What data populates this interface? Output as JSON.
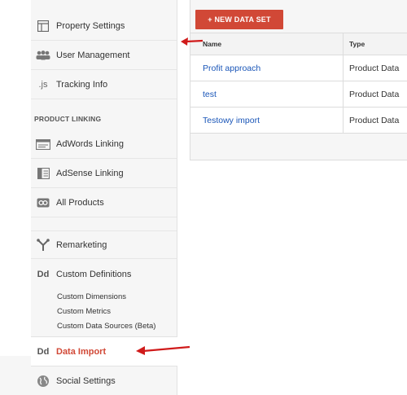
{
  "sidebar": {
    "items": [
      {
        "label": "Property Settings",
        "icon": "property-settings-icon"
      },
      {
        "label": "User Management",
        "icon": "users-icon"
      },
      {
        "label": "Tracking Info",
        "icon": "js-icon",
        "icon_text": ".js"
      }
    ],
    "section_header": "PRODUCT LINKING",
    "linking_items": [
      {
        "label": "AdWords Linking",
        "icon": "adwords-icon"
      },
      {
        "label": "AdSense Linking",
        "icon": "adsense-icon"
      },
      {
        "label": "All Products",
        "icon": "link-icon"
      }
    ],
    "remarketing": {
      "label": "Remarketing",
      "icon": "remarketing-icon"
    },
    "custom_definitions": {
      "label": "Custom Definitions",
      "icon_text": "Dd"
    },
    "sub_items": [
      "Custom Dimensions",
      "Custom Metrics",
      "Custom Data Sources (Beta)"
    ],
    "data_import": {
      "label": "Data Import",
      "icon_text": "Dd"
    },
    "social_settings": {
      "label": "Social Settings",
      "icon": "globe-icon"
    }
  },
  "main": {
    "new_button": "+ NEW DATA SET",
    "columns": [
      "Name",
      "Type"
    ],
    "rows": [
      {
        "name": "Profit approach",
        "type": "Product Data"
      },
      {
        "name": "test",
        "type": "Product Data"
      },
      {
        "name": "Testowy import",
        "type": "Product Data"
      }
    ]
  },
  "colors": {
    "accent": "#d14836",
    "link": "#1a56b8"
  }
}
